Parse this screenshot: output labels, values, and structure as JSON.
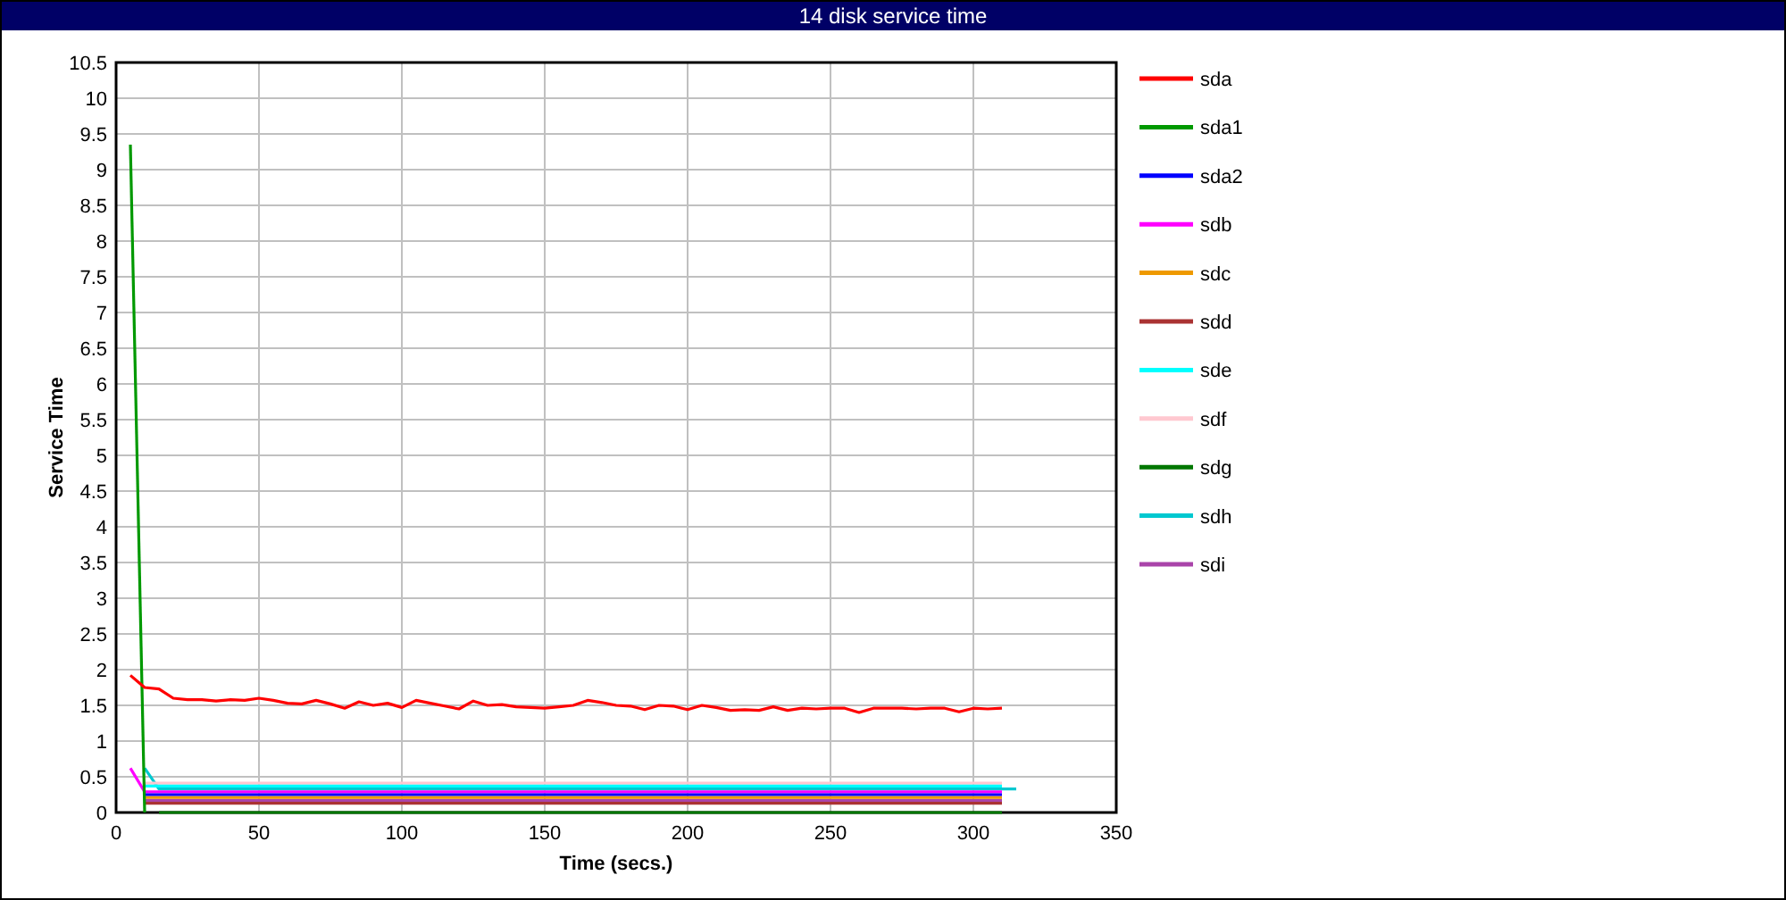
{
  "window": {
    "title": "14 disk service time"
  },
  "chart": {
    "chart_data": {
      "type": "line",
      "xlabel": "Time (secs.)",
      "ylabel": "Service Time",
      "xlim": [
        0,
        350
      ],
      "ylim": [
        0,
        10.5
      ],
      "grid": true,
      "legend": true,
      "xticks": [
        0,
        50,
        100,
        150,
        200,
        250,
        300,
        350
      ],
      "yticks": [
        0,
        0.5,
        1,
        1.5,
        2,
        2.5,
        3,
        3.5,
        4,
        4.5,
        5,
        5.5,
        6,
        6.5,
        7,
        7.5,
        8,
        8.5,
        9,
        9.5,
        10,
        10.5
      ],
      "x": [
        5,
        10,
        15,
        20,
        25,
        30,
        35,
        40,
        45,
        50,
        55,
        60,
        65,
        70,
        75,
        80,
        85,
        90,
        95,
        100,
        105,
        110,
        115,
        120,
        125,
        130,
        135,
        140,
        145,
        150,
        155,
        160,
        165,
        170,
        175,
        180,
        185,
        190,
        195,
        200,
        205,
        210,
        215,
        220,
        225,
        230,
        235,
        240,
        245,
        250,
        255,
        260,
        265,
        270,
        275,
        280,
        285,
        290,
        295,
        300,
        305,
        310,
        315
      ],
      "series": [
        {
          "name": "sda",
          "color": "#ff0000",
          "values": [
            1.92,
            1.75,
            1.73,
            1.6,
            1.58,
            1.58,
            1.56,
            1.58,
            1.57,
            1.6,
            1.57,
            1.53,
            1.52,
            1.57,
            1.52,
            1.46,
            1.55,
            1.5,
            1.53,
            1.47,
            1.57,
            1.53,
            1.49,
            1.45,
            1.56,
            1.5,
            1.51,
            1.48,
            1.47,
            1.46,
            1.48,
            1.5,
            1.57,
            1.54,
            1.5,
            1.49,
            1.44,
            1.5,
            1.49,
            1.44,
            1.5,
            1.47,
            1.43,
            1.44,
            1.43,
            1.48,
            1.43,
            1.46,
            1.45,
            1.46,
            1.46,
            1.4,
            1.46,
            1.46,
            1.46,
            1.45,
            1.46,
            1.46,
            1.41,
            1.46,
            1.45,
            1.46,
            null
          ]
        },
        {
          "name": "sda1",
          "color": "#009900",
          "values": [
            9.35,
            0,
            null,
            null,
            null,
            null,
            null,
            null,
            null,
            null,
            null,
            null,
            null,
            null,
            null,
            null,
            null,
            null,
            null,
            null,
            null,
            null,
            null,
            null,
            null,
            null,
            null,
            null,
            null,
            null,
            null,
            null,
            null,
            null,
            null,
            null,
            null,
            null,
            null,
            null,
            null,
            null,
            null,
            null,
            null,
            null,
            null,
            null,
            null,
            null,
            null,
            null,
            null,
            null,
            null,
            null,
            null,
            null,
            null,
            null,
            null,
            null,
            null
          ]
        },
        {
          "name": "sda2",
          "color": "#0000ff",
          "values": [
            null,
            0.25,
            0.25,
            0.25,
            0.25,
            0.25,
            0.25,
            0.25,
            0.25,
            0.25,
            0.25,
            0.25,
            0.25,
            0.25,
            0.25,
            0.25,
            0.25,
            0.25,
            0.25,
            0.25,
            0.25,
            0.25,
            0.25,
            0.25,
            0.25,
            0.25,
            0.25,
            0.25,
            0.25,
            0.25,
            0.25,
            0.25,
            0.25,
            0.25,
            0.25,
            0.25,
            0.25,
            0.25,
            0.25,
            0.25,
            0.25,
            0.25,
            0.25,
            0.25,
            0.25,
            0.25,
            0.25,
            0.25,
            0.25,
            0.25,
            0.25,
            0.25,
            0.25,
            0.25,
            0.25,
            0.25,
            0.25,
            0.25,
            0.25,
            0.25,
            0.25,
            0.25,
            null
          ]
        },
        {
          "name": "sdb",
          "color": "#ff00ff",
          "values": [
            0.62,
            0.29,
            0.29,
            0.29,
            0.29,
            0.29,
            0.29,
            0.29,
            0.29,
            0.29,
            0.29,
            0.29,
            0.29,
            0.29,
            0.29,
            0.29,
            0.29,
            0.29,
            0.29,
            0.29,
            0.29,
            0.29,
            0.29,
            0.29,
            0.29,
            0.29,
            0.29,
            0.29,
            0.29,
            0.29,
            0.29,
            0.29,
            0.29,
            0.29,
            0.29,
            0.29,
            0.29,
            0.29,
            0.29,
            0.29,
            0.29,
            0.29,
            0.29,
            0.29,
            0.29,
            0.29,
            0.29,
            0.29,
            0.29,
            0.29,
            0.29,
            0.29,
            0.29,
            0.29,
            0.29,
            0.29,
            0.29,
            0.29,
            0.29,
            0.29,
            0.29,
            0.29,
            null
          ]
        },
        {
          "name": "sdc",
          "color": "#ee9900",
          "values": [
            null,
            0.21,
            0.21,
            0.21,
            0.21,
            0.21,
            0.21,
            0.21,
            0.21,
            0.21,
            0.21,
            0.21,
            0.21,
            0.21,
            0.21,
            0.21,
            0.21,
            0.21,
            0.21,
            0.21,
            0.21,
            0.21,
            0.21,
            0.21,
            0.21,
            0.21,
            0.21,
            0.21,
            0.21,
            0.21,
            0.21,
            0.21,
            0.21,
            0.21,
            0.21,
            0.21,
            0.21,
            0.21,
            0.21,
            0.21,
            0.21,
            0.21,
            0.21,
            0.21,
            0.21,
            0.21,
            0.21,
            0.21,
            0.21,
            0.21,
            0.21,
            0.21,
            0.21,
            0.21,
            0.21,
            0.21,
            0.21,
            0.21,
            0.21,
            0.21,
            0.21,
            0.21,
            null
          ]
        },
        {
          "name": "sdd",
          "color": "#aa3333",
          "values": [
            null,
            0.13,
            0.13,
            0.13,
            0.13,
            0.13,
            0.13,
            0.13,
            0.13,
            0.13,
            0.13,
            0.13,
            0.13,
            0.13,
            0.13,
            0.13,
            0.13,
            0.13,
            0.13,
            0.13,
            0.13,
            0.13,
            0.13,
            0.13,
            0.13,
            0.13,
            0.13,
            0.13,
            0.13,
            0.13,
            0.13,
            0.13,
            0.13,
            0.13,
            0.13,
            0.13,
            0.13,
            0.13,
            0.13,
            0.13,
            0.13,
            0.13,
            0.13,
            0.13,
            0.13,
            0.13,
            0.13,
            0.13,
            0.13,
            0.13,
            0.13,
            0.13,
            0.13,
            0.13,
            0.13,
            0.13,
            0.13,
            0.13,
            0.13,
            0.13,
            0.13,
            0.13,
            null
          ]
        },
        {
          "name": "sde",
          "color": "#00ffff",
          "values": [
            null,
            0.37,
            0.37,
            0.37,
            0.37,
            0.37,
            0.37,
            0.37,
            0.37,
            0.37,
            0.37,
            0.37,
            0.37,
            0.37,
            0.37,
            0.37,
            0.37,
            0.37,
            0.37,
            0.37,
            0.37,
            0.37,
            0.37,
            0.37,
            0.37,
            0.37,
            0.37,
            0.37,
            0.37,
            0.37,
            0.37,
            0.37,
            0.37,
            0.37,
            0.37,
            0.37,
            0.37,
            0.37,
            0.37,
            0.37,
            0.37,
            0.37,
            0.37,
            0.37,
            0.37,
            0.37,
            0.37,
            0.37,
            0.37,
            0.37,
            0.37,
            0.37,
            0.37,
            0.37,
            0.37,
            0.37,
            0.37,
            0.37,
            0.37,
            0.37,
            0.37,
            0.37,
            null
          ]
        },
        {
          "name": "sdf",
          "color": "#ffc8d0",
          "values": [
            null,
            0.41,
            0.41,
            0.41,
            0.41,
            0.41,
            0.41,
            0.41,
            0.41,
            0.41,
            0.41,
            0.41,
            0.41,
            0.41,
            0.41,
            0.41,
            0.41,
            0.41,
            0.41,
            0.41,
            0.41,
            0.41,
            0.41,
            0.41,
            0.41,
            0.41,
            0.41,
            0.41,
            0.41,
            0.41,
            0.41,
            0.41,
            0.41,
            0.41,
            0.41,
            0.41,
            0.41,
            0.41,
            0.41,
            0.41,
            0.41,
            0.41,
            0.41,
            0.41,
            0.41,
            0.41,
            0.41,
            0.41,
            0.41,
            0.41,
            0.41,
            0.41,
            0.41,
            0.41,
            0.41,
            0.41,
            0.41,
            0.41,
            0.41,
            0.41,
            0.41,
            0.41,
            null
          ]
        },
        {
          "name": "sdg",
          "color": "#007700",
          "values": [
            null,
            null,
            0,
            0,
            0,
            0,
            0,
            0,
            0,
            0,
            0,
            0,
            0,
            0,
            0,
            0,
            0,
            0,
            0,
            0,
            0,
            0,
            0,
            0,
            0,
            0,
            0,
            0,
            0,
            0,
            0,
            0,
            0,
            0,
            0,
            0,
            0,
            0,
            0,
            0,
            0,
            0,
            0,
            0,
            0,
            0,
            0,
            0,
            0,
            0,
            0,
            0,
            0,
            0,
            0,
            0,
            0,
            0,
            0,
            0,
            0,
            0,
            null
          ]
        },
        {
          "name": "sdh",
          "color": "#00c8d0",
          "values": [
            null,
            0.62,
            0.33,
            0.33,
            0.33,
            0.33,
            0.33,
            0.33,
            0.33,
            0.33,
            0.33,
            0.33,
            0.33,
            0.33,
            0.33,
            0.33,
            0.33,
            0.33,
            0.33,
            0.33,
            0.33,
            0.33,
            0.33,
            0.33,
            0.33,
            0.33,
            0.33,
            0.33,
            0.33,
            0.33,
            0.33,
            0.33,
            0.33,
            0.33,
            0.33,
            0.33,
            0.33,
            0.33,
            0.33,
            0.33,
            0.33,
            0.33,
            0.33,
            0.33,
            0.33,
            0.33,
            0.33,
            0.33,
            0.33,
            0.33,
            0.33,
            0.33,
            0.33,
            0.33,
            0.33,
            0.33,
            0.33,
            0.33,
            0.33,
            0.33,
            0.33,
            0.33,
            0.33
          ]
        },
        {
          "name": "sdi",
          "color": "#aa44aa",
          "values": [
            null,
            0.17,
            0.17,
            0.17,
            0.17,
            0.17,
            0.17,
            0.17,
            0.17,
            0.17,
            0.17,
            0.17,
            0.17,
            0.17,
            0.17,
            0.17,
            0.17,
            0.17,
            0.17,
            0.17,
            0.17,
            0.17,
            0.17,
            0.17,
            0.17,
            0.17,
            0.17,
            0.17,
            0.17,
            0.17,
            0.17,
            0.17,
            0.17,
            0.17,
            0.17,
            0.17,
            0.17,
            0.17,
            0.17,
            0.17,
            0.17,
            0.17,
            0.17,
            0.17,
            0.17,
            0.17,
            0.17,
            0.17,
            0.17,
            0.17,
            0.17,
            0.17,
            0.17,
            0.17,
            0.17,
            0.17,
            0.17,
            0.17,
            0.17,
            0.17,
            0.17,
            0.17,
            null
          ]
        }
      ]
    }
  }
}
